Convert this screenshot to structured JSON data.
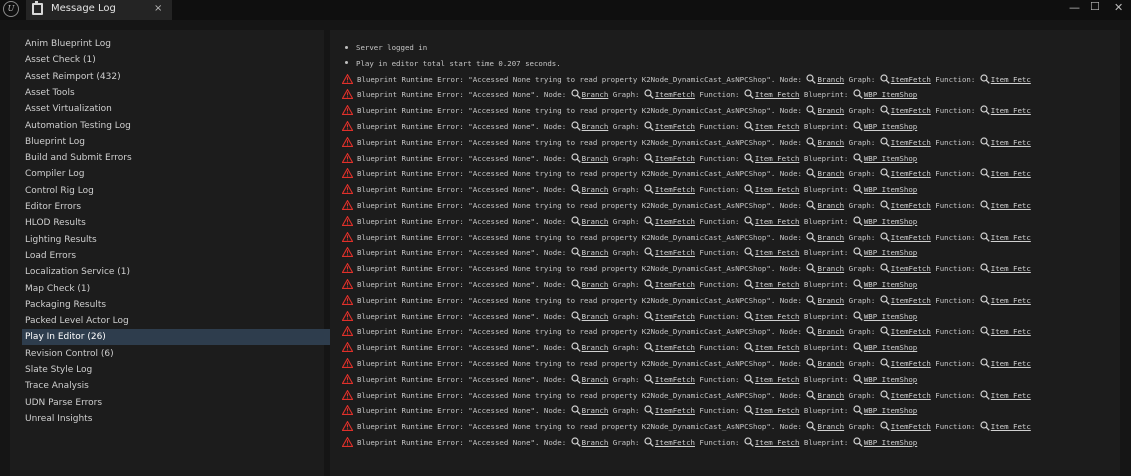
{
  "window": {
    "tab_label": "Message Log",
    "tab_close": "×",
    "logo_text": "U",
    "min": "—",
    "max": "☐",
    "close": "✕"
  },
  "categories": [
    "Anim Blueprint Log",
    "Asset Check (1)",
    "Asset Reimport (432)",
    "Asset Tools",
    "Asset Virtualization",
    "Automation Testing Log",
    "Blueprint Log",
    "Build and Submit Errors",
    "Compiler Log",
    "Control Rig Log",
    "Editor Errors",
    "HLOD Results",
    "Lighting Results",
    "Load Errors",
    "Localization Service (1)",
    "Map Check (1)",
    "Packaging Results",
    "Packed Level Actor Log",
    "Play In Editor (26)",
    "Revision Control (6)",
    "Slate Style Log",
    "Trace Analysis",
    "UDN Parse Errors",
    "Unreal Insights"
  ],
  "selected_category": 18,
  "info_messages": [
    "Server logged in",
    "Play in editor total start time 0.207 seconds."
  ],
  "error_prefix": "Blueprint Runtime Error:",
  "error_a": {
    "msg": "\"Accessed None trying to read property K2Node_DynamicCast_AsNPCShop\".",
    "node_lbl": "Node:",
    "node": "Branch",
    "graph_lbl": "Graph:",
    "graph": "ItemFetch",
    "func_lbl": "Function:",
    "func": "Item Fetc"
  },
  "error_b": {
    "msg": "\"Accessed None\".",
    "node_lbl": "Node:",
    "node": "Branch",
    "graph_lbl": "Graph:",
    "graph": "ItemFetch",
    "func_lbl": "Function:",
    "func": "Item Fetch",
    "bp_lbl": "Blueprint:",
    "bp": "WBP_ItemShop"
  },
  "error_pattern": [
    "a",
    "b",
    "a",
    "b",
    "a",
    "b",
    "a",
    "b",
    "a",
    "b",
    "a",
    "b",
    "a",
    "b",
    "a",
    "b",
    "a",
    "b",
    "a",
    "b",
    "a",
    "b",
    "a",
    "b"
  ],
  "colors": {
    "accent_selected": "#2e3d4d",
    "error": "#e0302a"
  }
}
